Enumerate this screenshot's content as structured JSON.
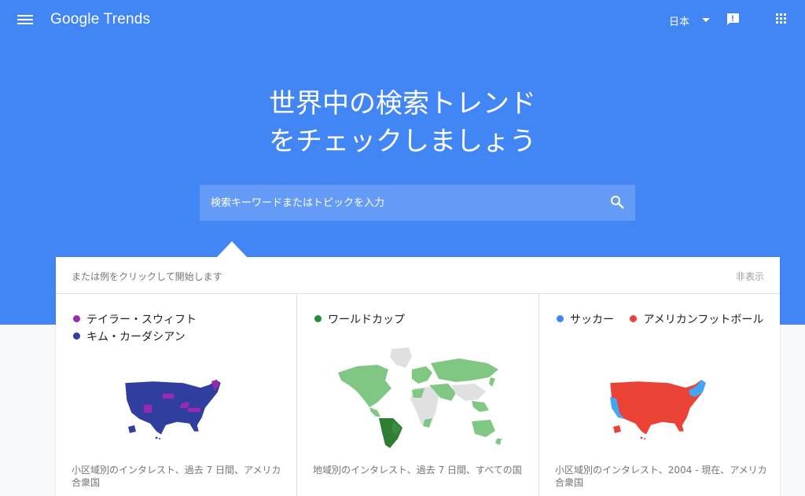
{
  "header": {
    "app_name": "Google Trends",
    "country": "日本"
  },
  "hero": {
    "title_line1": "世界中の検索トレンド",
    "title_line2": "をチェックしましょう"
  },
  "search": {
    "placeholder": "検索キーワードまたはトピックを入力"
  },
  "examples": {
    "hint": "または例をクリックして開始します",
    "hide_label": "非表示",
    "cards": [
      {
        "terms": [
          {
            "label": "テイラー・スウィフト",
            "color": "#9c27b0"
          },
          {
            "label": "キム・カーダシアン",
            "color": "#303f9f"
          }
        ],
        "caption": "小区域別のインタレスト、過去 7 日間、アメリカ合衆国"
      },
      {
        "terms": [
          {
            "label": "ワールドカップ",
            "color": "#1e8e3e"
          }
        ],
        "caption": "地域別のインタレスト、過去 7 日間、すべての国"
      },
      {
        "terms": [
          {
            "label": "サッカー",
            "color": "#4285f4"
          },
          {
            "label": "アメリカンフットボール",
            "color": "#ea4335"
          }
        ],
        "caption": "小区域別のインタレスト、2004 - 現在、アメリカ合衆国"
      }
    ]
  },
  "colors": {
    "brand_blue": "#4285f4",
    "purple": "#9c27b0",
    "indigo": "#303f9f",
    "green_light": "#81c784",
    "green_dark": "#2e7d32",
    "red": "#ea4335",
    "blue": "#42a5f5"
  }
}
